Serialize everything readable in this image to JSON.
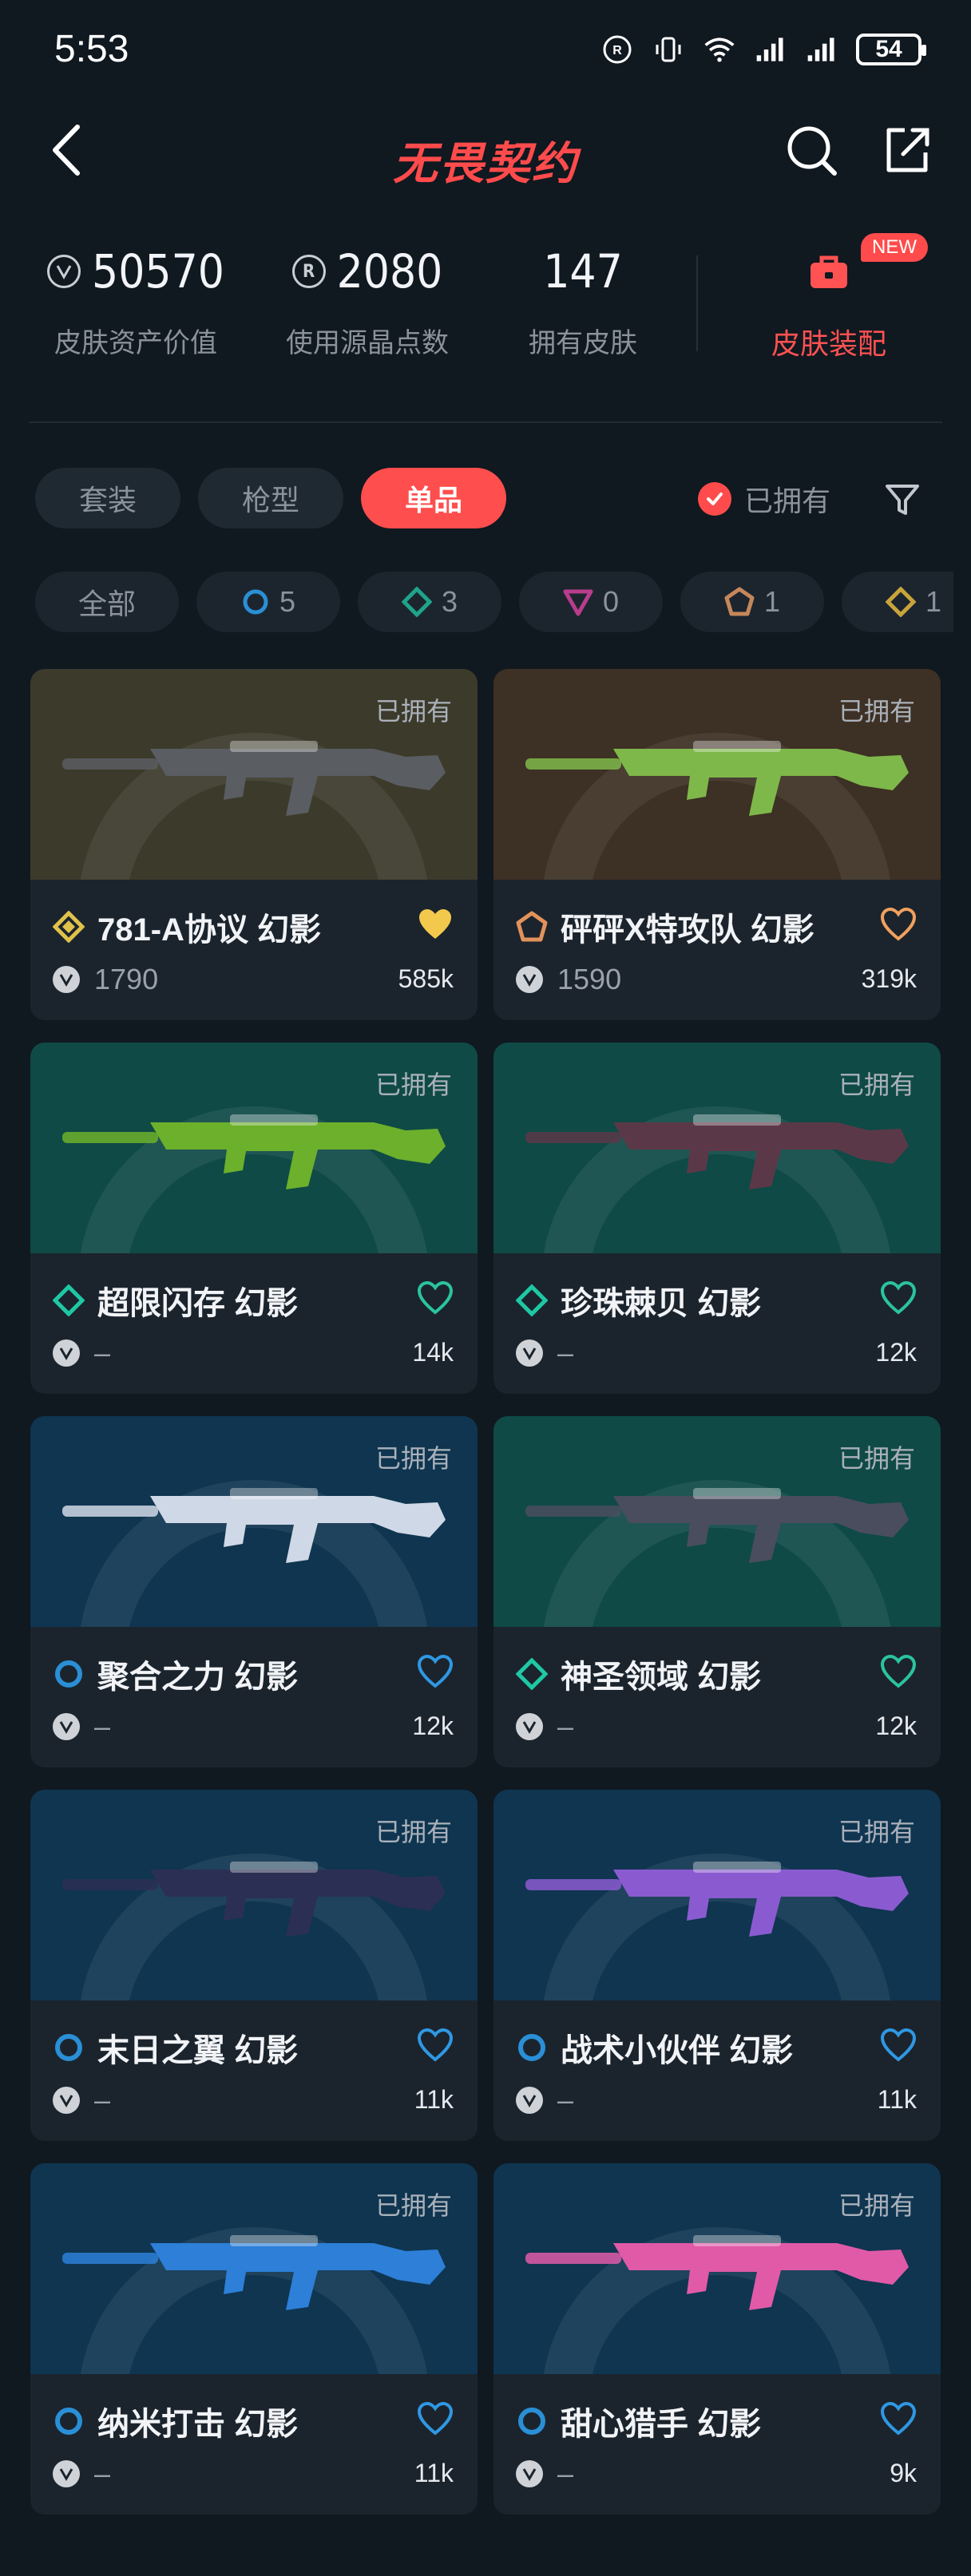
{
  "status_bar": {
    "time": "5:53",
    "battery": "54",
    "network_label": "6"
  },
  "header": {
    "logo_text": "无畏契约"
  },
  "stats": [
    {
      "value": "50570",
      "label": "皮肤资产价值",
      "icon": "vp-coin-icon"
    },
    {
      "value": "2080",
      "label": "使用源晶点数",
      "icon": "radianite-icon"
    },
    {
      "value": "147",
      "label": "拥有皮肤"
    }
  ],
  "equip": {
    "label": "皮肤装配",
    "badge": "NEW"
  },
  "tabs": [
    {
      "label": "套装",
      "active": false
    },
    {
      "label": "枪型",
      "active": false
    },
    {
      "label": "单品",
      "active": true
    }
  ],
  "owned_filter": {
    "label": "已拥有",
    "checked": true
  },
  "rarity_chips": [
    {
      "label": "全部",
      "count": "",
      "color": ""
    },
    {
      "label": "",
      "count": "5",
      "color": "#2a8fd6"
    },
    {
      "label": "",
      "count": "3",
      "color": "#1fa38a"
    },
    {
      "label": "",
      "count": "0",
      "color": "#b93d8c"
    },
    {
      "label": "",
      "count": "1",
      "color": "#c5875a"
    },
    {
      "label": "",
      "count": "1",
      "color": "#c9a43a"
    }
  ],
  "cards": [
    {
      "name": "781-A协议 幻影",
      "price": "1790",
      "likes": "585k",
      "owned": "已拥有",
      "rarity_color": "#e0c24a",
      "fav_filled": true,
      "fav_color": "#f2c94c",
      "bg": "#3c3a2a",
      "gun": "#5a5d62"
    },
    {
      "name": "砰砰X特攻队 幻影",
      "price": "1590",
      "likes": "319k",
      "owned": "已拥有",
      "rarity_color": "#e2925a",
      "fav_filled": false,
      "fav_color": "#f0a15e",
      "bg": "#3d3024",
      "gun": "#7fb84a"
    },
    {
      "name": "超限闪存 幻影",
      "price": "–",
      "likes": "14k",
      "owned": "已拥有",
      "rarity_color": "#1fc8a4",
      "fav_filled": false,
      "fav_color": "#2bc3a0",
      "bg": "#0f4a46",
      "gun": "#6cb02c"
    },
    {
      "name": "珍珠棘贝 幻影",
      "price": "–",
      "likes": "12k",
      "owned": "已拥有",
      "rarity_color": "#1fc8a4",
      "fav_filled": false,
      "fav_color": "#2bc3a0",
      "bg": "#0f4a46",
      "gun": "#5b3848"
    },
    {
      "name": "聚合之力 幻影",
      "price": "–",
      "likes": "12k",
      "owned": "已拥有",
      "rarity_color": "#2a8fd6",
      "fav_filled": false,
      "fav_color": "#2f98e3",
      "bg": "#0f3550",
      "gun": "#cfd8e6"
    },
    {
      "name": "神圣领域 幻影",
      "price": "–",
      "likes": "12k",
      "owned": "已拥有",
      "rarity_color": "#1fc8a4",
      "fav_filled": false,
      "fav_color": "#2bc3a0",
      "bg": "#0f4a46",
      "gun": "#4a4d5e"
    },
    {
      "name": "末日之翼 幻影",
      "price": "–",
      "likes": "11k",
      "owned": "已拥有",
      "rarity_color": "#2a8fd6",
      "fav_filled": false,
      "fav_color": "#2f98e3",
      "bg": "#0f3550",
      "gun": "#2c2f54"
    },
    {
      "name": "战术小伙伴 幻影",
      "price": "–",
      "likes": "11k",
      "owned": "已拥有",
      "rarity_color": "#2a8fd6",
      "fav_filled": false,
      "fav_color": "#2f98e3",
      "bg": "#0f3550",
      "gun": "#8a5bd0"
    },
    {
      "name": "纳米打击 幻影",
      "price": "–",
      "likes": "11k",
      "owned": "已拥有",
      "rarity_color": "#2a8fd6",
      "fav_filled": false,
      "fav_color": "#2f98e3",
      "bg": "#0f3550",
      "gun": "#2d7fd8"
    },
    {
      "name": "甜心猎手 幻影",
      "price": "–",
      "likes": "9k",
      "owned": "已拥有",
      "rarity_color": "#2a8fd6",
      "fav_filled": false,
      "fav_color": "#2f98e3",
      "bg": "#0f3550",
      "gun": "#e05aa8"
    }
  ]
}
